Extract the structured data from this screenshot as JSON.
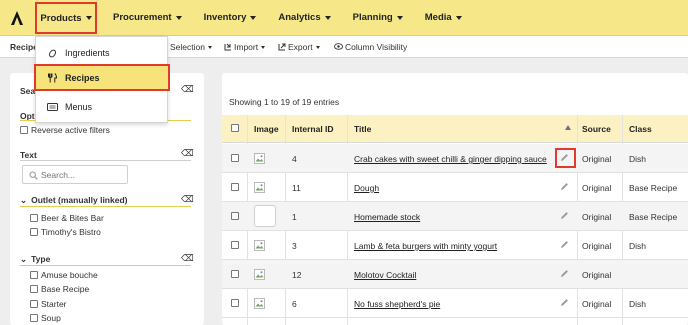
{
  "nav": {
    "items": [
      "Products",
      "Procurement",
      "Inventory",
      "Analytics",
      "Planning",
      "Media"
    ]
  },
  "toolbar": {
    "breadcrumb": "Recipe",
    "selection": "Selection",
    "import": "Import",
    "export": "Export",
    "column_visibility": "Column Visibility"
  },
  "dropdown": {
    "items": [
      "Ingredients",
      "Recipes",
      "Menus"
    ]
  },
  "filters": {
    "search_title_partial": "Sea",
    "options_title_partial": "Opti",
    "reverse_label": "Reverse active filters",
    "text_title": "Text",
    "search_placeholder": "Search...",
    "outlet_title": "Outlet (manually linked)",
    "outlets": [
      "Beer & Bites Bar",
      "Timothy's Bistro"
    ],
    "type_title": "Type",
    "types": [
      "Amuse bouche",
      "Base Recipe",
      "Starter",
      "Soup"
    ]
  },
  "table": {
    "showing": "Showing 1 to 19 of 19 entries",
    "headers": {
      "image": "Image",
      "id": "Internal ID",
      "title": "Title",
      "source": "Source",
      "class": "Class"
    },
    "rows": [
      {
        "id": "4",
        "title": "Crab cakes with sweet chilli & ginger dipping sauce",
        "source": "Original",
        "class": "Dish"
      },
      {
        "id": "11",
        "title": "Dough",
        "source": "Original",
        "class": "Base Recipe"
      },
      {
        "id": "1",
        "title": "Homemade stock",
        "source": "Original",
        "class": "Base Recipe"
      },
      {
        "id": "3",
        "title": "Lamb & feta burgers with minty yogurt",
        "source": "Original",
        "class": "Dish"
      },
      {
        "id": "12",
        "title": "Molotov Cocktail",
        "source": "Original",
        "class": ""
      },
      {
        "id": "6",
        "title": "No fuss shepherd's pie",
        "source": "Original",
        "class": "Dish"
      }
    ]
  },
  "colors": {
    "nav_bg": "#f6e889",
    "highlight": "#e03a2f",
    "header_bg": "#fbf1c2"
  }
}
